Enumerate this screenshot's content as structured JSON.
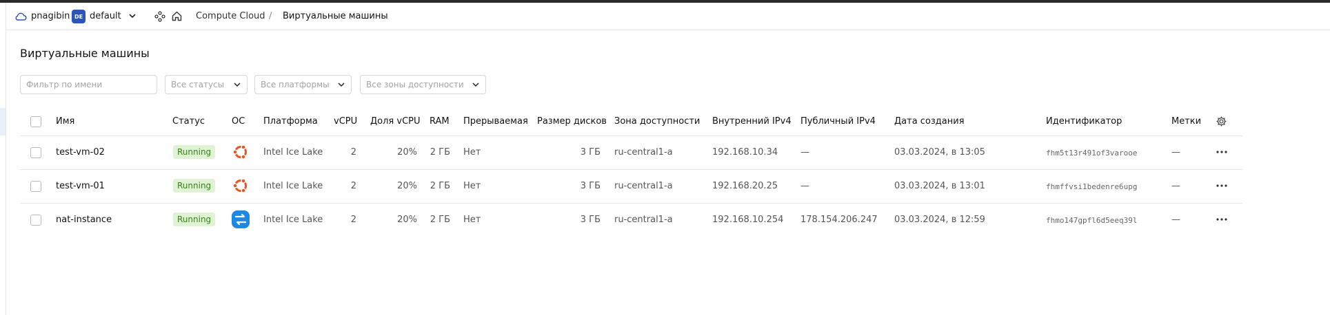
{
  "header": {
    "user": "pnagibin",
    "folder_badge": "DE",
    "folder": "default",
    "breadcrumbs": [
      "Compute Cloud",
      "/",
      "Виртуальные машины"
    ]
  },
  "page": {
    "title": "Виртуальные машины"
  },
  "filters": {
    "name_placeholder": "Фильтр по имени",
    "status": "Все статусы",
    "platform": "Все платформы",
    "zone": "Все зоны доступности"
  },
  "table": {
    "columns": [
      "Имя",
      "Статус",
      "ОС",
      "Платформа",
      "vCPU",
      "Доля vCPU",
      "RAM",
      "Прерываемая",
      "Размер дисков",
      "Зона доступности",
      "Внутренний IPv4",
      "Публичный IPv4",
      "Дата создания",
      "Идентификатор",
      "Метки"
    ],
    "rows": [
      {
        "name": "test-vm-02",
        "status": "Running",
        "os": "ubuntu-icon",
        "platform": "Intel Ice Lake",
        "vcpu": "2",
        "vcpu_share": "20%",
        "ram": "2 ГБ",
        "preemptible": "Нет",
        "disk": "3 ГБ",
        "zone": "ru-central1-a",
        "ipv4_internal": "192.168.10.34",
        "ipv4_public": "—",
        "created": "03.03.2024, в 13:05",
        "id": "fhm5t13r491of3varooe",
        "labels": "—"
      },
      {
        "name": "test-vm-01",
        "status": "Running",
        "os": "ubuntu-icon",
        "platform": "Intel Ice Lake",
        "vcpu": "2",
        "vcpu_share": "20%",
        "ram": "2 ГБ",
        "preemptible": "Нет",
        "disk": "3 ГБ",
        "zone": "ru-central1-a",
        "ipv4_internal": "192.168.20.25",
        "ipv4_public": "—",
        "created": "03.03.2024, в 13:01",
        "id": "fhmffvsi1bedenre6upg",
        "labels": "—"
      },
      {
        "name": "nat-instance",
        "status": "Running",
        "os": "nat-instance-icon",
        "platform": "Intel Ice Lake",
        "vcpu": "2",
        "vcpu_share": "20%",
        "ram": "2 ГБ",
        "preemptible": "Нет",
        "disk": "3 ГБ",
        "zone": "ru-central1-a",
        "ipv4_internal": "192.168.10.254",
        "ipv4_public": "178.154.206.247",
        "created": "03.03.2024, в 12:59",
        "id": "fhmo147gpfl6d5eeq39l",
        "labels": "—"
      }
    ]
  },
  "colors": {
    "accent": "#2b56b8",
    "running_bg": "#dff3d4",
    "running_text": "#3a7d1f",
    "ubuntu": "#e95420",
    "nat": "#1e88e5"
  }
}
